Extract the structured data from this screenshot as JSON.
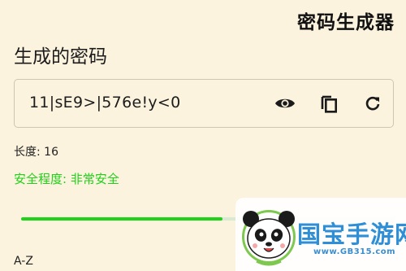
{
  "header": {
    "app_title": "密码生成器"
  },
  "password_section": {
    "title": "生成的密码",
    "value": "11|sE9>|576e!y<0",
    "icons": {
      "toggle_visibility": "eye-icon",
      "copy": "copy-icon",
      "regenerate": "refresh-icon"
    }
  },
  "length": {
    "label": "长度: 16",
    "slider_fraction": 0.54
  },
  "strength": {
    "label": "安全程度: 非常安全",
    "color": "#22d01a"
  },
  "charset": {
    "label": "A-Z"
  },
  "watermark": {
    "brand": "国宝手游网",
    "url": "www.GB315.com"
  },
  "colors": {
    "background": "#fbf3de",
    "accent": "#1ed41a"
  }
}
